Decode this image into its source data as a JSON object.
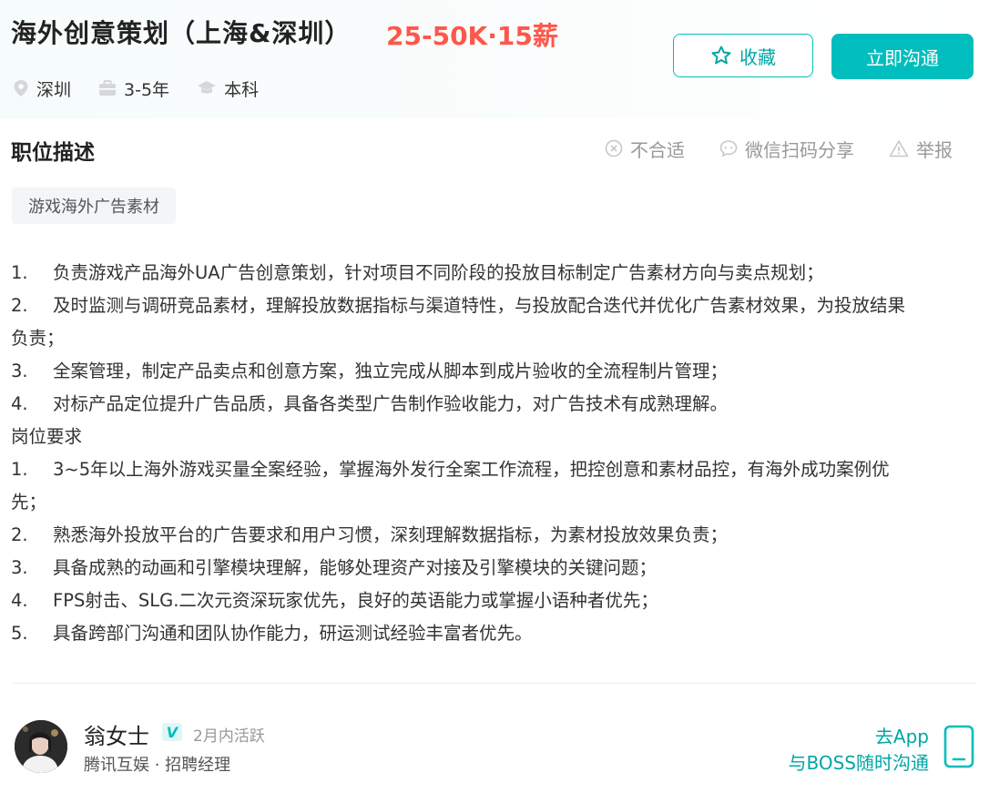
{
  "job": {
    "title": "海外创意策划（上海&深圳）",
    "salary": "25-50K·15薪",
    "meta": {
      "location": "深圳",
      "experience": "3-5年",
      "education": "本科"
    }
  },
  "buttons": {
    "favorite_label": "收藏",
    "chat_label": "立即沟通"
  },
  "section": {
    "title": "职位描述",
    "actions": {
      "not_fit": "不合适",
      "share": "微信扫码分享",
      "report": "举报"
    }
  },
  "tags": [
    "游戏海外广告素材"
  ],
  "description": {
    "lines": [
      {
        "num": "1.",
        "text": "负责游戏产品海外UA广告创意策划，针对项目不同阶段的投放目标制定广告素材方向与卖点规划；"
      },
      {
        "num": "2.",
        "text": "及时监测与调研竞品素材，理解投放数据指标与渠道特性，与投放配合迭代并优化广告素材效果，为投放结果"
      },
      {
        "num": "",
        "text": "负责；"
      },
      {
        "num": "3.",
        "text": "全案管理，制定产品卖点和创意方案，独立完成从脚本到成片验收的全流程制片管理；"
      },
      {
        "num": "4.",
        "text": "对标产品定位提升广告品质，具备各类型广告制作验收能力，对广告技术有成熟理解。"
      },
      {
        "num": "",
        "text": "岗位要求"
      },
      {
        "num": "1.",
        "text": "3~5年以上海外游戏买量全案经验，掌握海外发行全案工作流程，把控创意和素材品控，有海外成功案例优"
      },
      {
        "num": "",
        "text": "先；"
      },
      {
        "num": "2.",
        "text": "熟悉海外投放平台的广告要求和用户习惯，深刻理解数据指标，为素材投放效果负责；"
      },
      {
        "num": "3.",
        "text": "具备成熟的动画和引擎模块理解，能够处理资产对接及引擎模块的关键问题；"
      },
      {
        "num": "4.",
        "text": "FPS射击、SLG.二次元资深玩家优先，良好的英语能力或掌握小语种者优先；"
      },
      {
        "num": "5.",
        "text": "具备跨部门沟通和团队协作能力，研运测试经验丰富者优先。"
      }
    ]
  },
  "recruiter": {
    "name": "翁女士",
    "verified_badge": "V",
    "active": "2月内活跃",
    "company_role": "腾讯互娱 · 招聘经理"
  },
  "app_promo": {
    "line1": "去App",
    "line2": "与BOSS随时沟通"
  },
  "colors": {
    "brand": "#00bebd",
    "salary": "#fe574a"
  }
}
